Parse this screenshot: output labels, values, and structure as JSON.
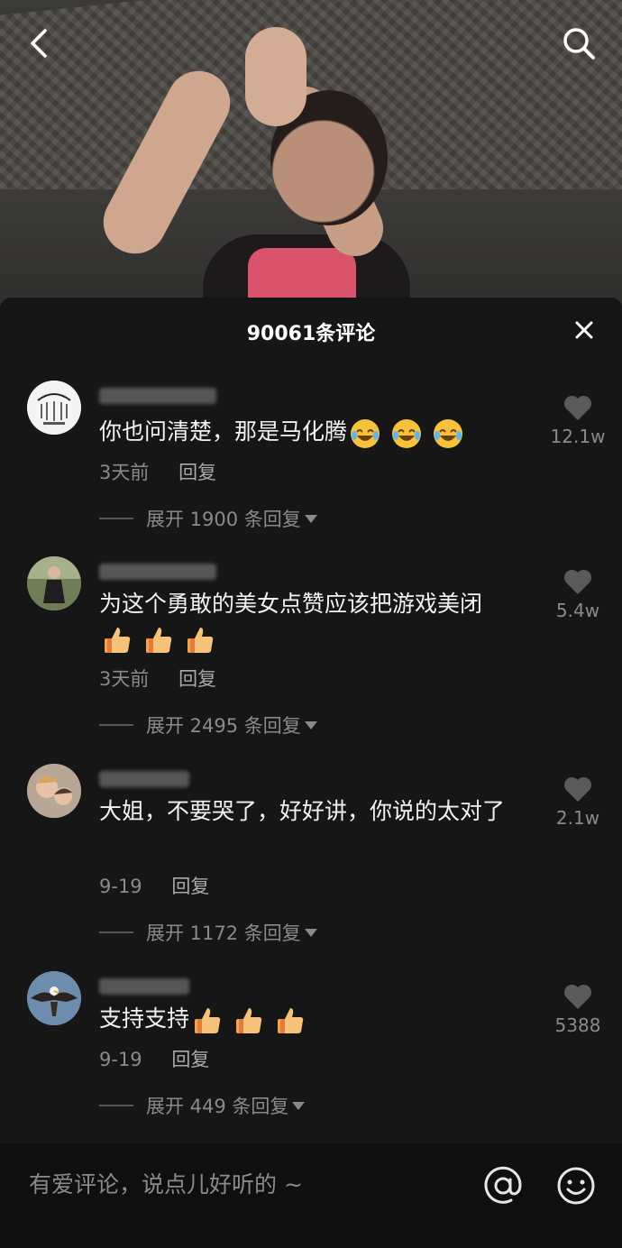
{
  "sheet": {
    "title": "90061条评论"
  },
  "comments": [
    {
      "text": "你也问清楚，那是马化腾",
      "emojis": [
        "laugh-cry",
        "laugh-cry",
        "laugh-cry"
      ],
      "time": "3天前",
      "reply": "回复",
      "expand": "展开 1900 条回复",
      "likes": "12.1w"
    },
    {
      "text": "为这个勇敢的美女点赞应该把游戏美闭",
      "emojis": [
        "thumbs-up",
        "thumbs-up",
        "thumbs-up"
      ],
      "time": "3天前",
      "reply": "回复",
      "expand": "展开 2495 条回复",
      "likes": "5.4w"
    },
    {
      "text": "大姐，不要哭了，好好讲，你说的太对了",
      "emojis": [],
      "time": "9-19",
      "reply": "回复",
      "expand": "展开 1172 条回复",
      "likes": "2.1w"
    },
    {
      "text": "支持支持",
      "emojis": [
        "thumbs-up",
        "thumbs-up",
        "thumbs-up"
      ],
      "time": "9-19",
      "reply": "回复",
      "expand": "展开 449 条回复",
      "likes": "5388"
    }
  ],
  "composer": {
    "placeholder": "有爱评论，说点儿好听的 ~"
  },
  "icons": {
    "back": "back-arrow-icon",
    "search": "search-icon",
    "close": "close-icon",
    "like": "heart-icon",
    "mention": "at-icon",
    "emoji": "smile-icon"
  },
  "colors": {
    "sheet_bg": "#161616",
    "muted_text": "#8a8a8a",
    "heart": "#5a5a5a"
  }
}
